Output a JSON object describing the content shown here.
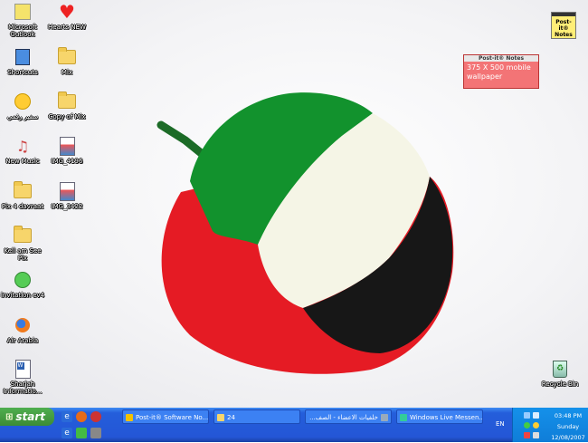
{
  "desktop": {
    "icons": [
      {
        "id": "outlook",
        "label": "Microsoft Outlook"
      },
      {
        "id": "hearts",
        "label": "Hearts NEW"
      },
      {
        "id": "shortcuts",
        "label": "Shortcuts"
      },
      {
        "id": "mix",
        "label": "Mix"
      },
      {
        "id": "smiley",
        "label": "سفير رقمي"
      },
      {
        "id": "copy-mix",
        "label": "Copy of Mix"
      },
      {
        "id": "new-music",
        "label": "New Music"
      },
      {
        "id": "img-4196",
        "label": "IMG_4196"
      },
      {
        "id": "pix",
        "label": "Pix 4 davraat"
      },
      {
        "id": "img-3422",
        "label": "IMG_3422"
      },
      {
        "id": "kell",
        "label": "Kell am See Pix"
      },
      {
        "id": "invitation",
        "label": "invitation ev4"
      },
      {
        "id": "air-arabia",
        "label": "Air Arabia"
      },
      {
        "id": "sharjah",
        "label": "Sharjah Informatio..."
      },
      {
        "id": "recycle",
        "label": "Recycle Bin"
      }
    ],
    "note": {
      "header": "Post-it® Notes",
      "text": "375 X 500 mobile wallpaper"
    },
    "postit_icon": "Post-it® Notes"
  },
  "taskbar": {
    "start_label": "start",
    "tasks": [
      {
        "label": "Post-it® Software No...",
        "icon_color": "#f2c100"
      },
      {
        "label": "24",
        "icon_color": "#f7d56b"
      },
      {
        "label": "خلفيات الاعضاء - الصف...",
        "icon_color": "#9ab"
      },
      {
        "label": "Windows Live Messen...",
        "icon_color": "#3c9"
      }
    ],
    "lang": "EN",
    "clock": {
      "time": "03:48 PM",
      "day": "Sunday",
      "date": "12/08/2007"
    }
  }
}
